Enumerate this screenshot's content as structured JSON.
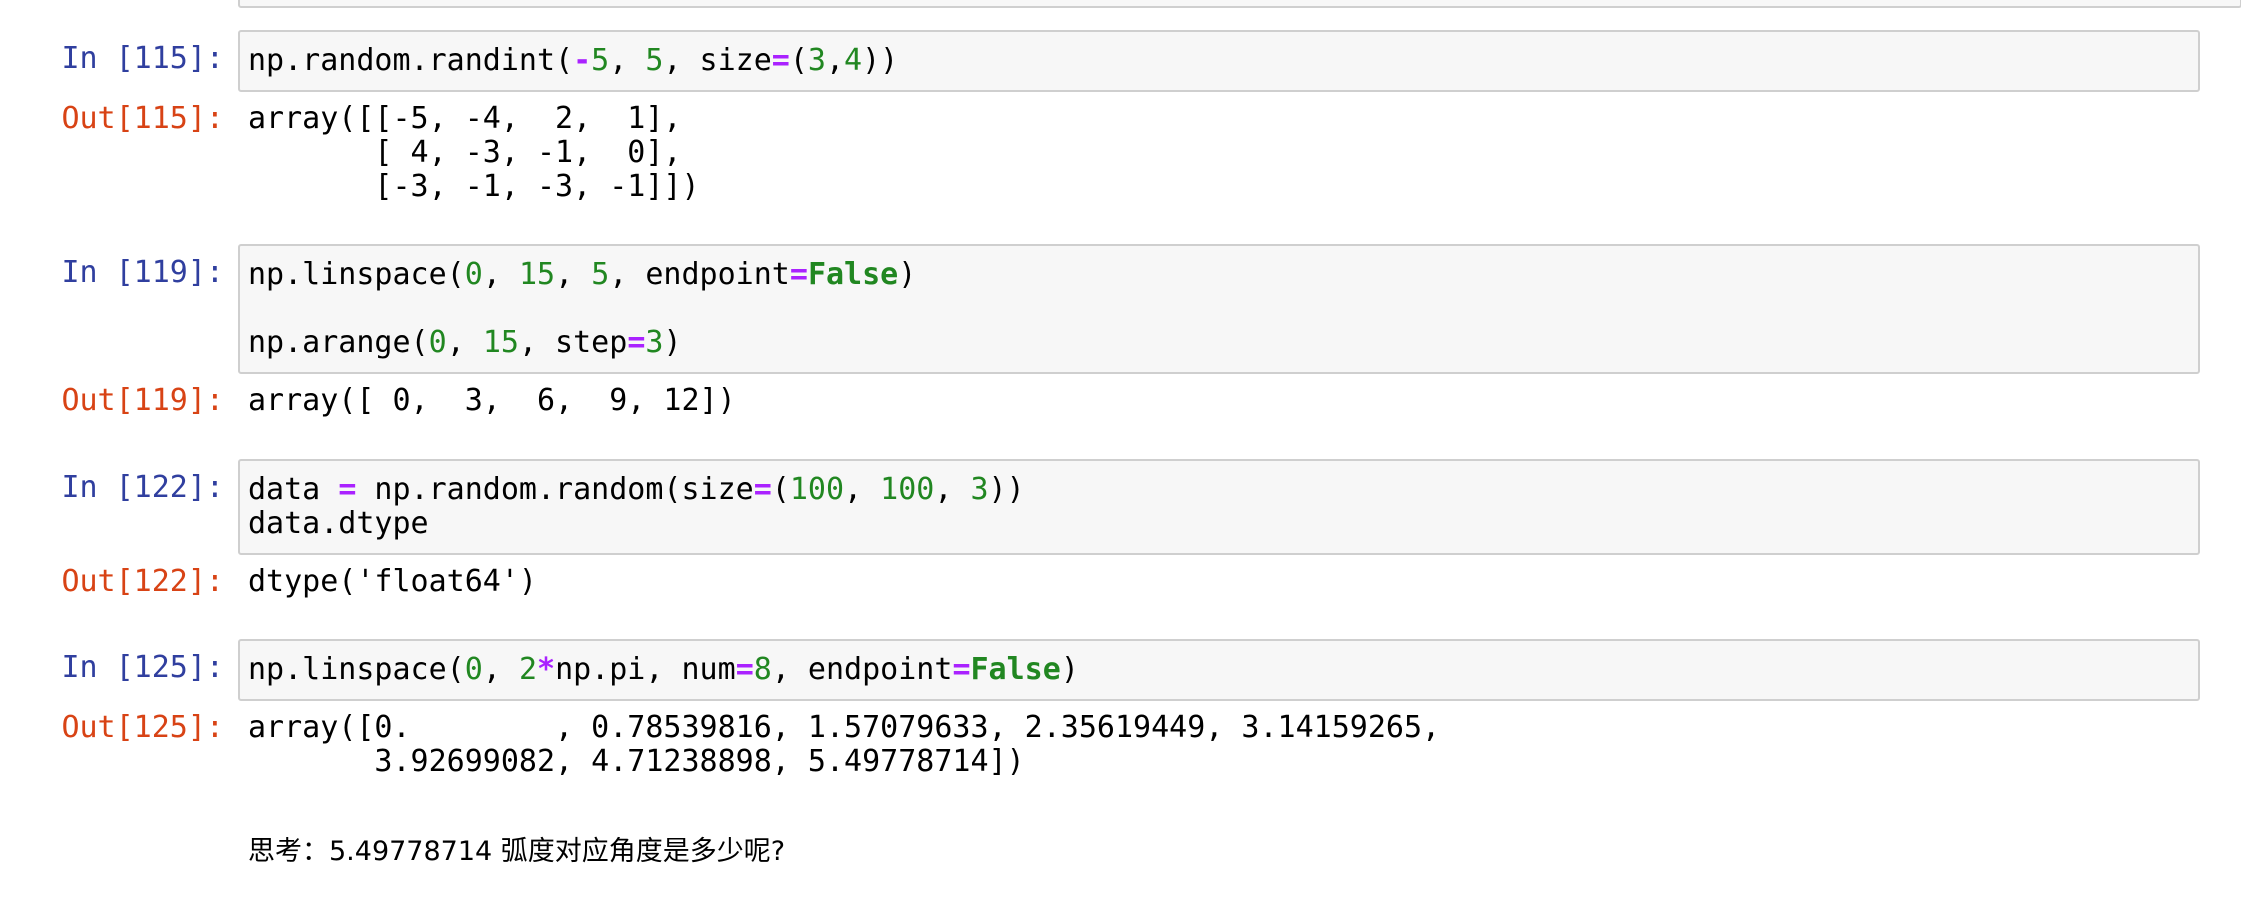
{
  "cells": [
    {
      "in_prompt": "In [115]:",
      "out_prompt": "Out[115]:",
      "code": [
        [
          {
            "t": "np.random.randint(",
            "c": ""
          },
          {
            "t": "-",
            "c": "op"
          },
          {
            "t": "5",
            "c": "num"
          },
          {
            "t": ", ",
            "c": ""
          },
          {
            "t": "5",
            "c": "num"
          },
          {
            "t": ", size",
            "c": ""
          },
          {
            "t": "=",
            "c": "op"
          },
          {
            "t": "(",
            "c": ""
          },
          {
            "t": "3",
            "c": "num"
          },
          {
            "t": ",",
            "c": ""
          },
          {
            "t": "4",
            "c": "num"
          },
          {
            "t": "))",
            "c": ""
          }
        ]
      ],
      "output": [
        "array([[-5, -4,  2,  1],",
        "       [ 4, -3, -1,  0],",
        "       [-3, -1, -3, -1]])"
      ]
    },
    {
      "in_prompt": "In [119]:",
      "out_prompt": "Out[119]:",
      "code": [
        [
          {
            "t": "np.linspace(",
            "c": ""
          },
          {
            "t": "0",
            "c": "num"
          },
          {
            "t": ", ",
            "c": ""
          },
          {
            "t": "15",
            "c": "num"
          },
          {
            "t": ", ",
            "c": ""
          },
          {
            "t": "5",
            "c": "num"
          },
          {
            "t": ", endpoint",
            "c": ""
          },
          {
            "t": "=",
            "c": "op"
          },
          {
            "t": "False",
            "c": "kw"
          },
          {
            "t": ")",
            "c": ""
          }
        ],
        [],
        [
          {
            "t": "np.arange(",
            "c": ""
          },
          {
            "t": "0",
            "c": "num"
          },
          {
            "t": ", ",
            "c": ""
          },
          {
            "t": "15",
            "c": "num"
          },
          {
            "t": ", step",
            "c": ""
          },
          {
            "t": "=",
            "c": "op"
          },
          {
            "t": "3",
            "c": "num"
          },
          {
            "t": ")",
            "c": ""
          }
        ]
      ],
      "output": [
        "array([ 0,  3,  6,  9, 12])"
      ]
    },
    {
      "in_prompt": "In [122]:",
      "out_prompt": "Out[122]:",
      "code": [
        [
          {
            "t": "data ",
            "c": ""
          },
          {
            "t": "=",
            "c": "op"
          },
          {
            "t": " np.random.random(size",
            "c": ""
          },
          {
            "t": "=",
            "c": "op"
          },
          {
            "t": "(",
            "c": ""
          },
          {
            "t": "100",
            "c": "num"
          },
          {
            "t": ", ",
            "c": ""
          },
          {
            "t": "100",
            "c": "num"
          },
          {
            "t": ", ",
            "c": ""
          },
          {
            "t": "3",
            "c": "num"
          },
          {
            "t": "))",
            "c": ""
          }
        ],
        [
          {
            "t": "data.dtype",
            "c": ""
          }
        ]
      ],
      "output": [
        "dtype('float64')"
      ]
    },
    {
      "in_prompt": "In [125]:",
      "out_prompt": "Out[125]:",
      "code": [
        [
          {
            "t": "np.linspace(",
            "c": ""
          },
          {
            "t": "0",
            "c": "num"
          },
          {
            "t": ", ",
            "c": ""
          },
          {
            "t": "2",
            "c": "num"
          },
          {
            "t": "*",
            "c": "op"
          },
          {
            "t": "np.pi, num",
            "c": ""
          },
          {
            "t": "=",
            "c": "op"
          },
          {
            "t": "8",
            "c": "num"
          },
          {
            "t": ", endpoint",
            "c": ""
          },
          {
            "t": "=",
            "c": "op"
          },
          {
            "t": "False",
            "c": "kw"
          },
          {
            "t": ")",
            "c": ""
          }
        ]
      ],
      "output": [
        "array([0.        , 0.78539816, 1.57079633, 2.35619449, 3.14159265,",
        "       3.92699082, 4.71238898, 5.49778714])"
      ]
    }
  ],
  "markdown": {
    "text": "思考：5.49778714 弧度对应角度是多少呢?"
  },
  "colors": {
    "in_prompt": "#303f9f",
    "out_prompt": "#d84315",
    "number": "#218721",
    "operator": "#aa22ff",
    "keyword": "#218721",
    "cell_background": "#f7f7f7",
    "cell_border": "#cfcfcf"
  }
}
